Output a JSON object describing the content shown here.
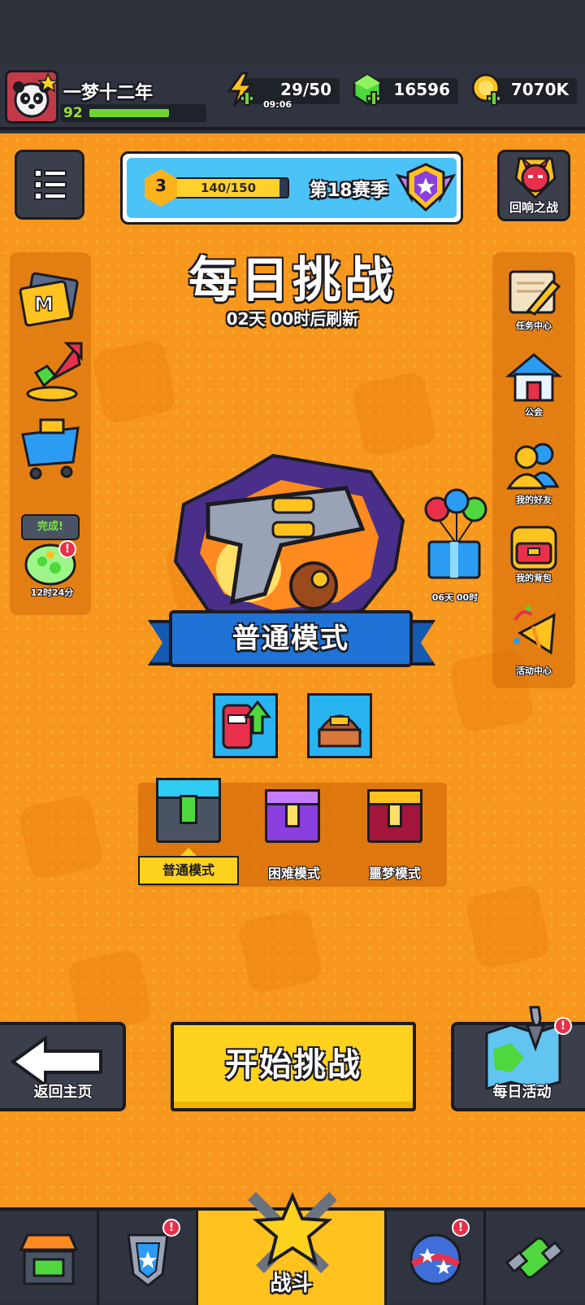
{
  "player": {
    "name": "一梦十二年",
    "level": "92",
    "level_progress": 0.72
  },
  "resources": {
    "energy": {
      "value": "29/50",
      "timer": "09:06"
    },
    "gems": {
      "value": "16596"
    },
    "coins": {
      "value": "7070K"
    }
  },
  "season": {
    "level": "3",
    "progress_text": "140/150",
    "progress": 0.93,
    "label": "第18赛季"
  },
  "top_right_button": {
    "label": "回响之战"
  },
  "challenge": {
    "title": "每日挑战",
    "refresh": "02天 00时后刷新",
    "mode_banner": "普通模式"
  },
  "left_side": {
    "complete_label": "完成!",
    "complete_timer": "12时24分"
  },
  "right_side": {
    "items": [
      {
        "label": "任务中心",
        "icon": "scroll-quill-icon"
      },
      {
        "label": "公会",
        "icon": "guild-house-icon"
      },
      {
        "label": "我的好友",
        "icon": "friends-icon"
      },
      {
        "label": "我的背包",
        "icon": "backpack-icon"
      },
      {
        "label": "活动中心",
        "icon": "party-horn-icon"
      }
    ],
    "gift_timer": "06天 00时"
  },
  "difficulties": [
    {
      "label": "普通模式",
      "selected": true
    },
    {
      "label": "困难模式",
      "selected": false
    },
    {
      "label": "噩梦模式",
      "selected": false
    }
  ],
  "actions": {
    "back": "返回主页",
    "start": "开始挑战",
    "daily": "每日活动"
  },
  "bottom_nav": {
    "battle": "战斗"
  },
  "colors": {
    "background": "#f7971e",
    "accent_yellow": "#ffd21f",
    "dark": "#1b1b22",
    "blue": "#1f73d6"
  }
}
